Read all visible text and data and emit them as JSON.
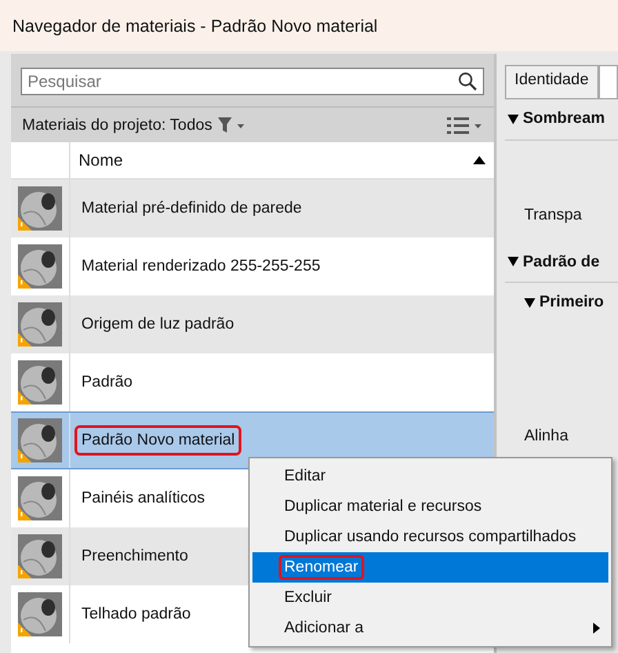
{
  "window": {
    "title": "Navegador de materiais - Padrão Novo material"
  },
  "search": {
    "placeholder": "Pesquisar"
  },
  "filter": {
    "label": "Materiais do projeto: Todos"
  },
  "table": {
    "columns": [
      "Nome"
    ],
    "rows": [
      {
        "name": "Material pré-definido de parede",
        "selected": false,
        "outlined": false
      },
      {
        "name": "Material renderizado 255-255-255",
        "selected": false,
        "outlined": false
      },
      {
        "name": "Origem de luz padrão",
        "selected": false,
        "outlined": false
      },
      {
        "name": "Padrão",
        "selected": false,
        "outlined": false
      },
      {
        "name": "Padrão Novo material",
        "selected": true,
        "outlined": true
      },
      {
        "name": "Painéis analíticos",
        "selected": false,
        "outlined": false
      },
      {
        "name": "Preenchimento",
        "selected": false,
        "outlined": false
      },
      {
        "name": "Telhado padrão",
        "selected": false,
        "outlined": false
      }
    ]
  },
  "properties": {
    "tabs": [
      {
        "label": "Identidade",
        "selected": false
      },
      {
        "selected": true
      }
    ],
    "items": [
      {
        "kind": "section",
        "label": "Sombream"
      },
      {
        "kind": "field",
        "label": "Transpa"
      },
      {
        "kind": "section",
        "label": "Padrão de"
      },
      {
        "kind": "subsection",
        "label": "Primeiro"
      },
      {
        "kind": "field",
        "label": "Alinha"
      }
    ]
  },
  "context_menu": {
    "items": [
      {
        "label": "Editar",
        "selected": false,
        "outlined": false,
        "submenu": false
      },
      {
        "label": "Duplicar material e recursos",
        "selected": false,
        "outlined": false,
        "submenu": false
      },
      {
        "label": "Duplicar usando recursos compartilhados",
        "selected": false,
        "outlined": false,
        "submenu": false
      },
      {
        "label": "Renomear",
        "selected": true,
        "outlined": true,
        "submenu": false
      },
      {
        "label": "Excluir",
        "selected": false,
        "outlined": false,
        "submenu": false
      },
      {
        "label": "Adicionar a",
        "selected": false,
        "outlined": false,
        "submenu": true
      }
    ]
  }
}
